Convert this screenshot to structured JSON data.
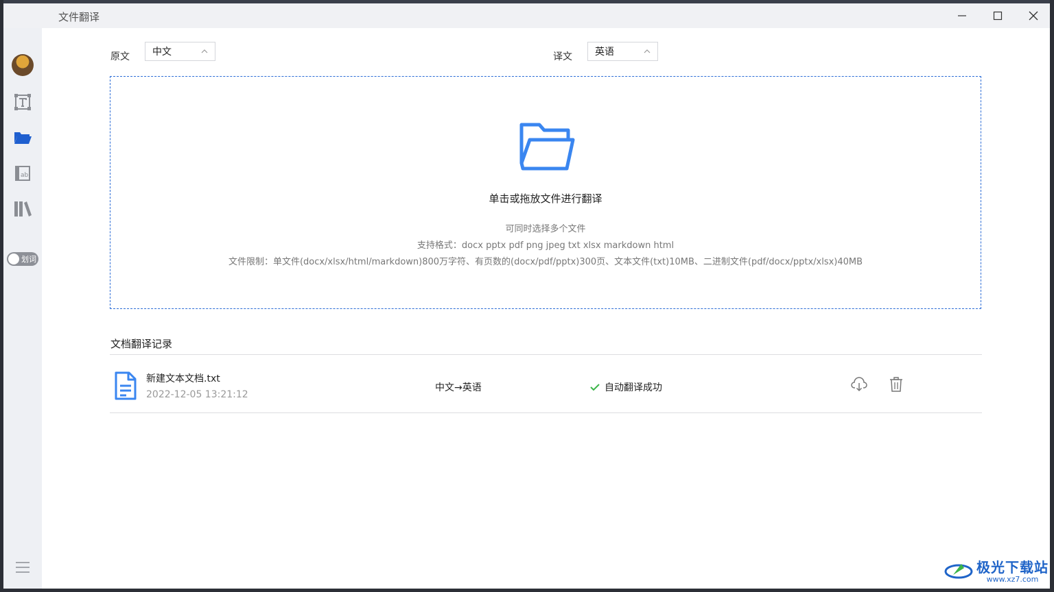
{
  "window": {
    "title": "文件翻译"
  },
  "sidebar": {
    "items": [
      {
        "name": "avatar"
      },
      {
        "name": "text-translate-icon"
      },
      {
        "name": "folder-icon",
        "active": true
      },
      {
        "name": "image-translate-icon"
      },
      {
        "name": "library-icon"
      }
    ],
    "toggle_label": "划词",
    "toggle_on": false,
    "menu_icon": "menu-icon"
  },
  "lang": {
    "source_label": "原文",
    "source_value": "中文",
    "target_label": "译文",
    "target_value": "英语"
  },
  "dropzone": {
    "main_text": "单击或拖放文件进行翻译",
    "line1": "可同时选择多个文件",
    "line2": "支持格式：docx pptx pdf png jpeg txt xlsx markdown html",
    "line3": "文件限制：单文件(docx/xlsx/html/markdown)800万字符、有页数的(docx/pdf/pptx)300页、文本文件(txt)10MB、二进制文件(pdf/docx/pptx/xlsx)40MB"
  },
  "records": {
    "title": "文档翻译记录",
    "items": [
      {
        "file_name": "新建文本文档.txt",
        "time": "2022-12-05 13:21:12",
        "direction": "中文→英语",
        "status": "自动翻译成功"
      }
    ]
  },
  "colors": {
    "accent": "#2a6bd6",
    "folder": "#3a86f0",
    "success": "#3bb54a"
  },
  "watermark": {
    "title": "极光下载站",
    "url": "www.xz7.com"
  }
}
